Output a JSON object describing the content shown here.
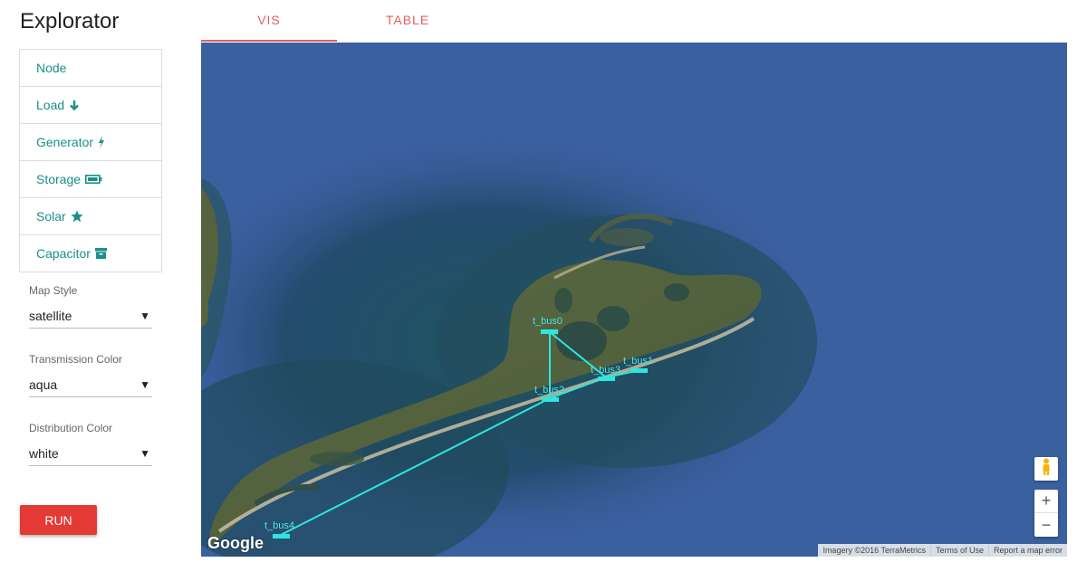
{
  "app": {
    "title": "Explorator"
  },
  "sidebar": {
    "items": [
      {
        "label": "Node",
        "icon": ""
      },
      {
        "label": "Load",
        "icon": "arrow-down-icon"
      },
      {
        "label": "Generator",
        "icon": "bolt-icon"
      },
      {
        "label": "Storage",
        "icon": "battery-icon"
      },
      {
        "label": "Solar",
        "icon": "star-icon"
      },
      {
        "label": "Capacitor",
        "icon": "archive-icon"
      }
    ]
  },
  "controls": {
    "map_style": {
      "label": "Map Style",
      "value": "satellite"
    },
    "transmission_color": {
      "label": "Transmission Color",
      "value": "aqua"
    },
    "distribution_color": {
      "label": "Distribution Color",
      "value": "white"
    },
    "run_label": "RUN"
  },
  "tabs": [
    {
      "label": "VIS",
      "active": true
    },
    {
      "label": "TABLE",
      "active": false
    }
  ],
  "map": {
    "buses": [
      "t_bus0",
      "t_bus1",
      "t_bus2",
      "t_bus3",
      "t_bus4"
    ],
    "google_logo": "Google",
    "attribution": [
      "Imagery ©2016 TerraMetrics",
      "Terms of Use",
      "Report a map error"
    ],
    "zoom_in": "+",
    "zoom_out": "−",
    "line_color": "#2ee6e0"
  },
  "colors": {
    "accent_teal": "#1b8f8a",
    "tab_red": "#e06060",
    "run_red": "#e53935"
  }
}
